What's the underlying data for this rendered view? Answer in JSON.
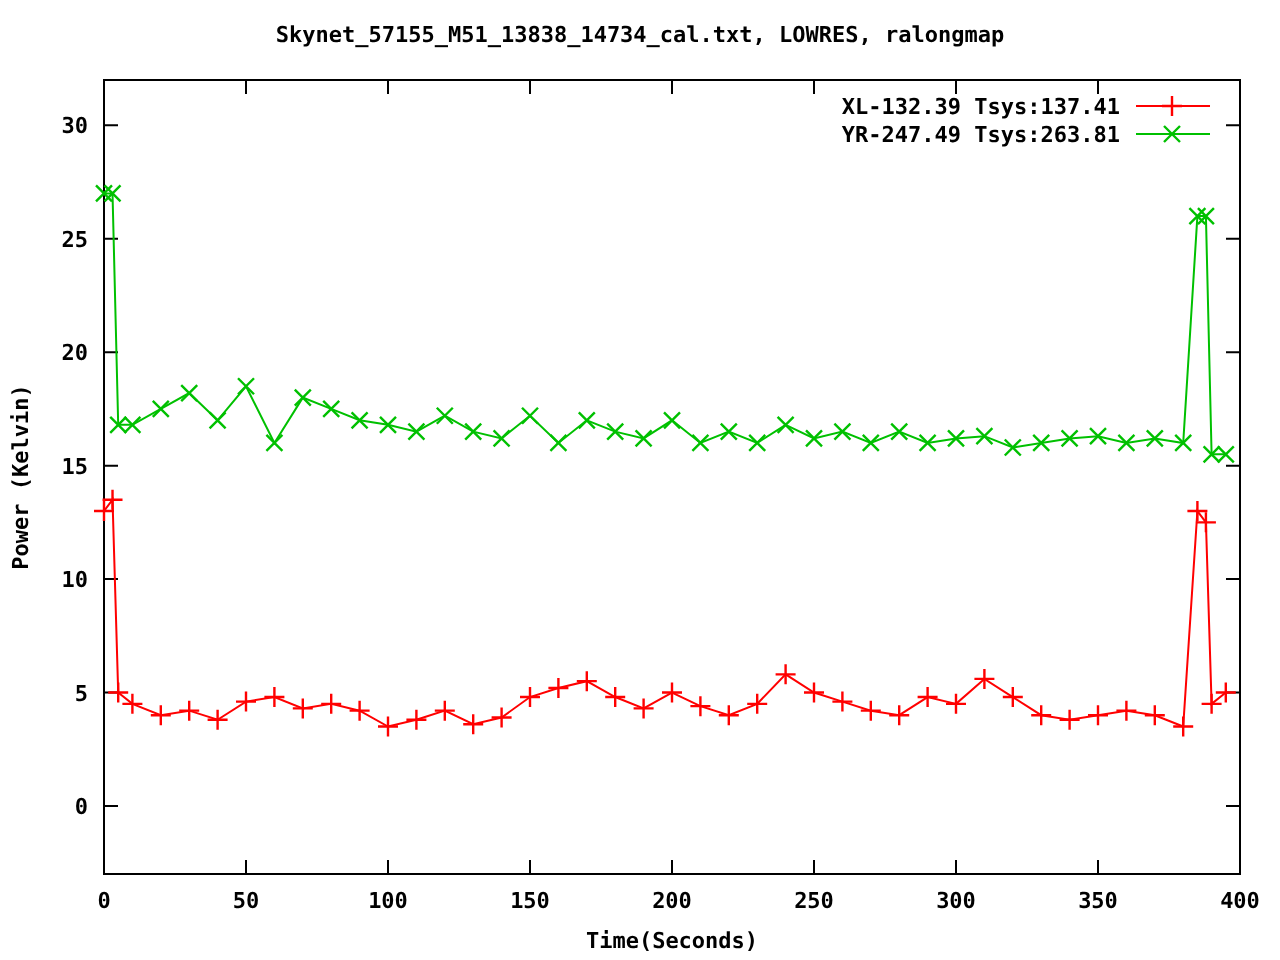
{
  "chart_data": {
    "type": "line",
    "title": "Skynet_57155_M51_13838_14734_cal.txt, LOWRES, ralongmap",
    "xlabel": "Time(Seconds)",
    "ylabel": "Power (Kelvin)",
    "x": [
      0,
      3,
      5,
      10,
      20,
      30,
      40,
      50,
      60,
      70,
      80,
      90,
      100,
      110,
      120,
      130,
      140,
      150,
      160,
      170,
      180,
      190,
      200,
      210,
      220,
      230,
      240,
      250,
      260,
      270,
      280,
      290,
      300,
      310,
      320,
      330,
      340,
      350,
      360,
      370,
      380,
      385,
      388,
      390,
      395
    ],
    "series": [
      {
        "name": "XL-132.39 Tsys:137.41",
        "color": "#ff0000",
        "marker": "plus",
        "values": [
          13,
          13.5,
          5,
          4.5,
          4,
          4.2,
          3.8,
          4.6,
          4.8,
          4.3,
          4.5,
          4.2,
          3.5,
          3.8,
          4.2,
          3.6,
          3.9,
          4.8,
          5.2,
          5.5,
          4.8,
          4.3,
          5,
          4.4,
          4,
          4.5,
          5.8,
          5,
          4.6,
          4.2,
          4,
          4.8,
          4.5,
          5.6,
          4.8,
          4,
          3.8,
          4,
          4.2,
          4,
          3.5,
          13,
          12.5,
          4.5,
          5
        ]
      },
      {
        "name": "YR-247.49 Tsys:263.81",
        "color": "#00c000",
        "marker": "cross",
        "values": [
          27,
          27,
          16.8,
          16.8,
          17.5,
          18.2,
          17,
          18.5,
          16,
          18,
          17.5,
          17,
          16.8,
          16.5,
          17.2,
          16.5,
          16.2,
          17.2,
          16,
          17,
          16.5,
          16.2,
          17,
          16,
          16.5,
          16,
          16.8,
          16.2,
          16.5,
          16,
          16.5,
          16,
          16.2,
          16.3,
          15.8,
          16,
          16.2,
          16.3,
          16,
          16.2,
          16,
          26,
          26,
          15.5,
          15.5
        ]
      }
    ],
    "xlim": [
      0,
      400
    ],
    "ylim": [
      -3,
      32
    ],
    "xticks": [
      0,
      50,
      100,
      150,
      200,
      250,
      300,
      350,
      400
    ],
    "yticks": [
      0,
      5,
      10,
      15,
      20,
      25,
      30
    ],
    "legend": true
  }
}
